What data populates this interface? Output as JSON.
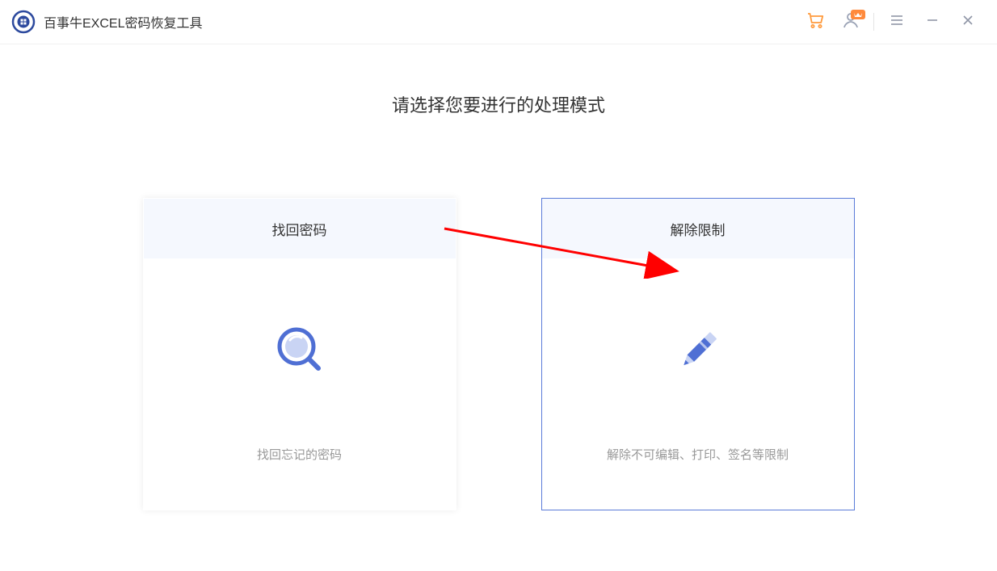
{
  "header": {
    "app_title": "百事牛EXCEL密码恢复工具"
  },
  "main": {
    "heading": "请选择您要进行的处理模式",
    "cards": [
      {
        "title": "找回密码",
        "description": "找回忘记的密码",
        "icon": "magnifier-icon",
        "selected": false
      },
      {
        "title": "解除限制",
        "description": "解除不可编辑、打印、签名等限制",
        "icon": "pencil-icon",
        "selected": true
      }
    ]
  },
  "colors": {
    "accent": "#5a7bd8",
    "cart": "#ff9a3c",
    "arrow": "#ff0000"
  }
}
